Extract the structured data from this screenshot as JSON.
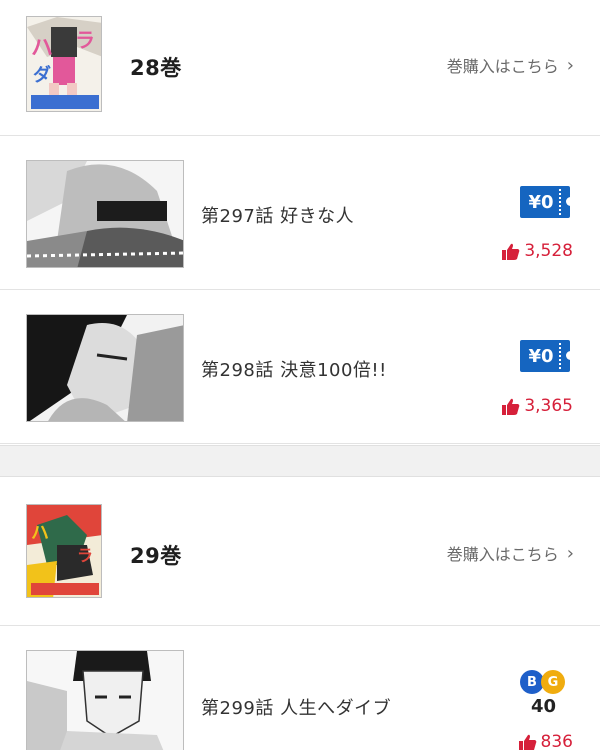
{
  "colors": {
    "accent_blue": "#1565c0",
    "like_red": "#d6203a",
    "bonus_b": "#1e5fc9",
    "bonus_g": "#f0ac0f"
  },
  "volumes": [
    {
      "title": "28巻",
      "buy_label": "巻購入はこちら",
      "chevron": "chevron-right-icon"
    },
    {
      "title": "29巻",
      "buy_label": "巻購入はこちら",
      "chevron": "chevron-right-icon"
    }
  ],
  "episodes": [
    {
      "title": "第297話 好きな人",
      "price": "¥0",
      "likes": "3,528"
    },
    {
      "title": "第298話 決意100倍!!",
      "price": "¥0",
      "likes": "3,365"
    },
    {
      "title": "第299話 人生へダイブ",
      "badge_b": "B",
      "badge_g": "G",
      "bonus_value": "40",
      "likes": "836"
    }
  ]
}
